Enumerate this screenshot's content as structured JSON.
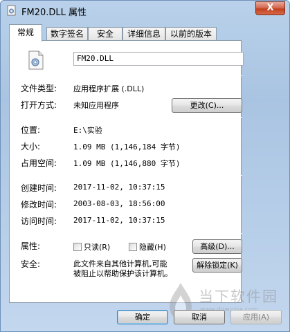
{
  "window": {
    "title": "FM20.DLL 属性",
    "close_label": "X"
  },
  "tabs": [
    {
      "label": "常规",
      "active": true
    },
    {
      "label": "数字签名",
      "active": false
    },
    {
      "label": "安全",
      "active": false
    },
    {
      "label": "详细信息",
      "active": false
    },
    {
      "label": "以前的版本",
      "active": false
    }
  ],
  "general": {
    "file_name": "FM20.DLL",
    "file_type_label": "文件类型:",
    "file_type_value": "应用程序扩展 (.DLL)",
    "opens_with_label": "打开方式:",
    "opens_with_value": "未知应用程序",
    "change_button": "更改(C)...",
    "location_label": "位置:",
    "location_value": "E:\\实验",
    "size_label": "大小:",
    "size_value": "1.09 MB (1,146,184 字节)",
    "size_on_disk_label": "占用空间:",
    "size_on_disk_value": "1.09 MB (1,146,880 字节)",
    "created_label": "创建时间:",
    "created_value": "2017-11-02, 10:37:15",
    "modified_label": "修改时间:",
    "modified_value": "2003-08-03, 18:56:00",
    "accessed_label": "访问时间:",
    "accessed_value": "2017-11-02, 10:37:15",
    "attributes_label": "属性:",
    "readonly_label": "只读(R)",
    "hidden_label": "隐藏(H)",
    "advanced_button": "高级(D)...",
    "security_label": "安全:",
    "security_text_line1": "此文件来自其他计算机,可能",
    "security_text_line2": "被阻止以帮助保护该计算机。",
    "unblock_button": "解除锁定(K)"
  },
  "footer": {
    "ok": "确定",
    "cancel": "取消",
    "apply": "应用(A)"
  },
  "watermark": {
    "text": "当下软件园",
    "url": "www.downxia.com"
  }
}
